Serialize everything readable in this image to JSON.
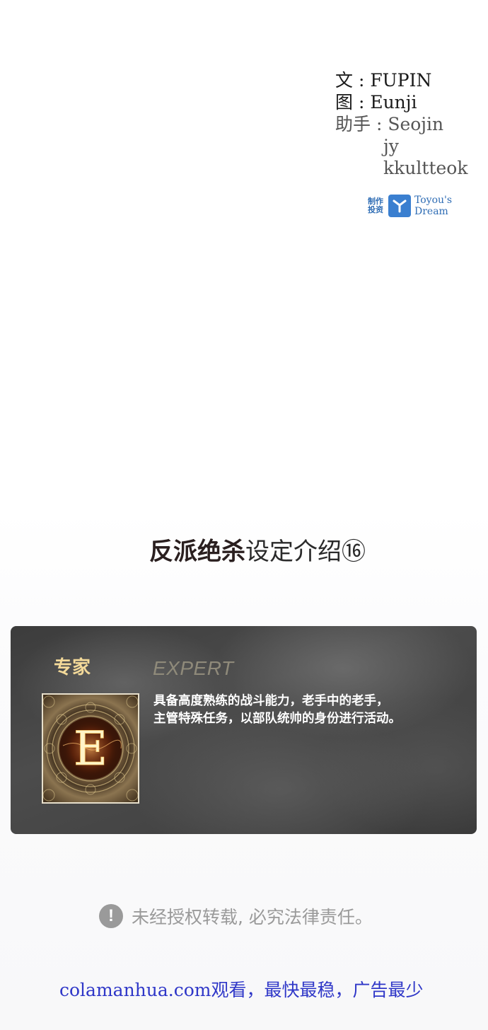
{
  "credits": {
    "writer_role": "文 :",
    "writer": "FUPIN",
    "artist_role": "图 :",
    "artist": "Eunji",
    "assistant_role": "助手 :",
    "assistants": [
      "Seojin",
      "jy",
      "kkultteok"
    ]
  },
  "producer": {
    "label_line1": "制作",
    "label_line2": "投资",
    "name_line1": "Toyou's",
    "name_line2": "Dream",
    "logo_icon": "y-logo-icon"
  },
  "section": {
    "title_bold": "反派绝杀",
    "title_rest": "设定介绍⑯"
  },
  "card": {
    "title": "专家",
    "subtitle": "EXPERT",
    "emblem_letter": "E",
    "description_line1": "具备高度熟练的战斗能力，老手中的老手，",
    "description_line2": "主管特殊任务，以部队统帅的身份进行活动。"
  },
  "notice": {
    "icon": "exclamation-icon",
    "text": "未经授权转载, 必究法律责任。"
  },
  "watermark": {
    "text": "colamanhua.com观看，最快最稳，广告最少"
  },
  "colors": {
    "producer_blue": "#3a7fd0",
    "card_title_gold": "#f3d999",
    "watermark_blue": "#2f37c8"
  }
}
